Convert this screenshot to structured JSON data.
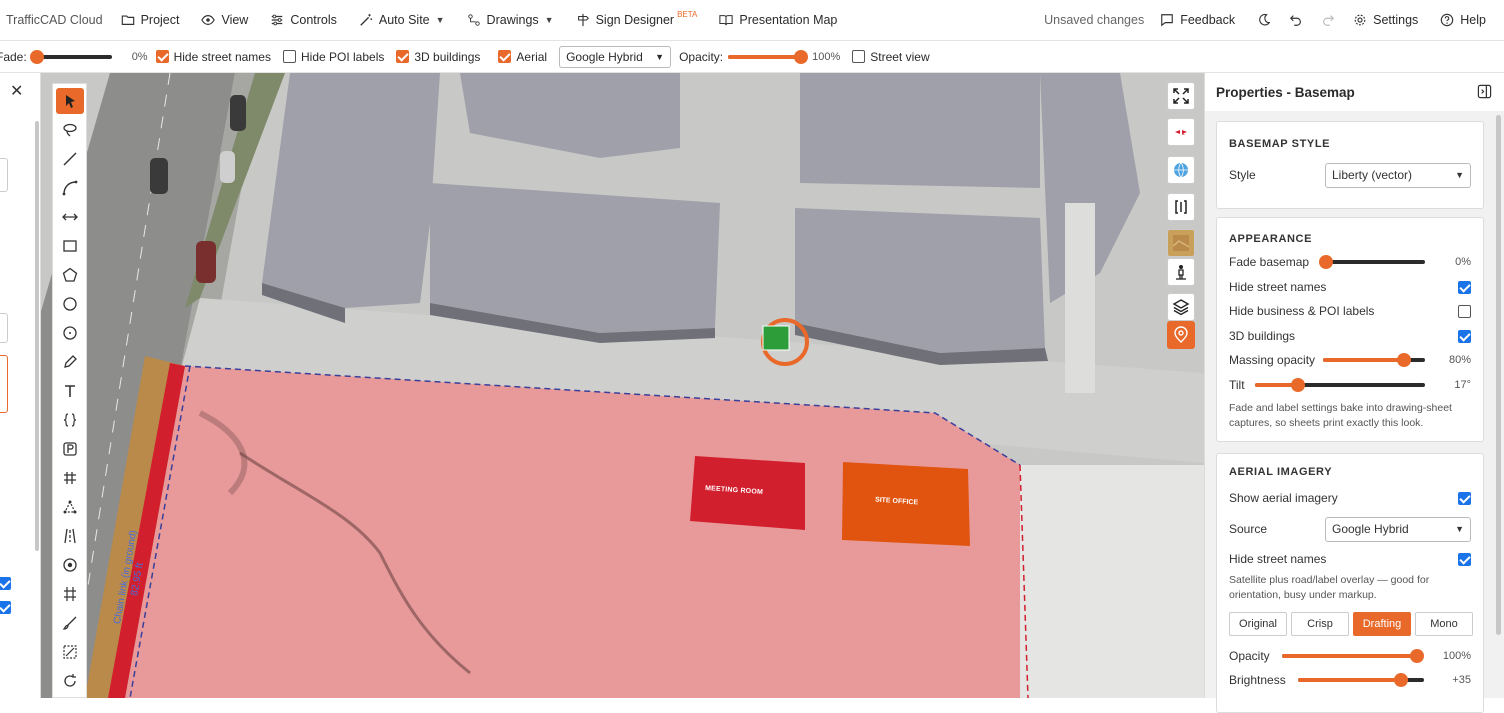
{
  "app": {
    "brand": "TrafficCAD Cloud"
  },
  "menu": {
    "project": "Project",
    "view": "View",
    "controls": "Controls",
    "auto_site": "Auto Site",
    "drawings": "Drawings",
    "sign_designer": "Sign Designer",
    "beta": "BETA",
    "presentation_map": "Presentation Map",
    "unsaved": "Unsaved changes",
    "feedback": "Feedback",
    "settings": "Settings",
    "help": "Help"
  },
  "options": {
    "fade_label": "Fade:",
    "fade_value": "0%",
    "fade_fraction": 0.0,
    "hide_street_names": {
      "label": "Hide street names",
      "checked": true
    },
    "hide_poi_labels": {
      "label": "Hide POI labels",
      "checked": false
    },
    "buildings_3d": {
      "label": "3D buildings",
      "checked": true
    },
    "aerial": {
      "label": "Aerial",
      "checked": true
    },
    "source": "Google Hybrid",
    "opacity_label": "Opacity:",
    "opacity_value": "100%",
    "opacity_fraction": 1.0,
    "street_view": {
      "label": "Street view",
      "checked": false
    }
  },
  "map": {
    "label_meeting": "MEETING ROOM",
    "label_office": "SITE OFFICE",
    "fence_label": "Chain link (in ground)",
    "fence_length": "82.95 ft"
  },
  "properties": {
    "title": "Properties - Basemap",
    "basemap_style": {
      "heading": "BASEMAP STYLE",
      "style_label": "Style",
      "style_value": "Liberty (vector)"
    },
    "appearance": {
      "heading": "APPEARANCE",
      "fade_label": "Fade basemap",
      "fade_value": "0%",
      "fade_fraction": 0.0,
      "hide_street_names": {
        "label": "Hide street names",
        "checked": true
      },
      "hide_poi": {
        "label": "Hide business & POI labels",
        "checked": false
      },
      "buildings_3d": {
        "label": "3D buildings",
        "checked": true
      },
      "massing_label": "Massing opacity",
      "massing_value": "80%",
      "massing_fraction": 0.8,
      "tilt_label": "Tilt",
      "tilt_value": "17°",
      "tilt_fraction": 0.25,
      "note": "Fade and label settings bake into drawing-sheet captures, so sheets print exactly this look."
    },
    "aerial": {
      "heading": "AERIAL IMAGERY",
      "show_label": "Show aerial imagery",
      "show_checked": true,
      "source_label": "Source",
      "source_value": "Google Hybrid",
      "hide_street_label": "Hide street names",
      "hide_street_checked": true,
      "note": "Satellite plus road/label overlay — good for orientation, busy under markup.",
      "presets": [
        "Original",
        "Crisp",
        "Drafting",
        "Mono"
      ],
      "preset_selected": "Drafting",
      "opacity_label": "Opacity",
      "opacity_value": "100%",
      "opacity_fraction": 1.0,
      "brightness_label": "Brightness",
      "brightness_value": "+35",
      "brightness_fraction": 0.83
    }
  },
  "colors": {
    "accent": "#e8692a",
    "check_blue": "#1a73e8",
    "site_fill": "#e89a9a",
    "building": "#9c9ca6",
    "meeting_room": "#d21f2e",
    "site_office": "#e0540f"
  }
}
